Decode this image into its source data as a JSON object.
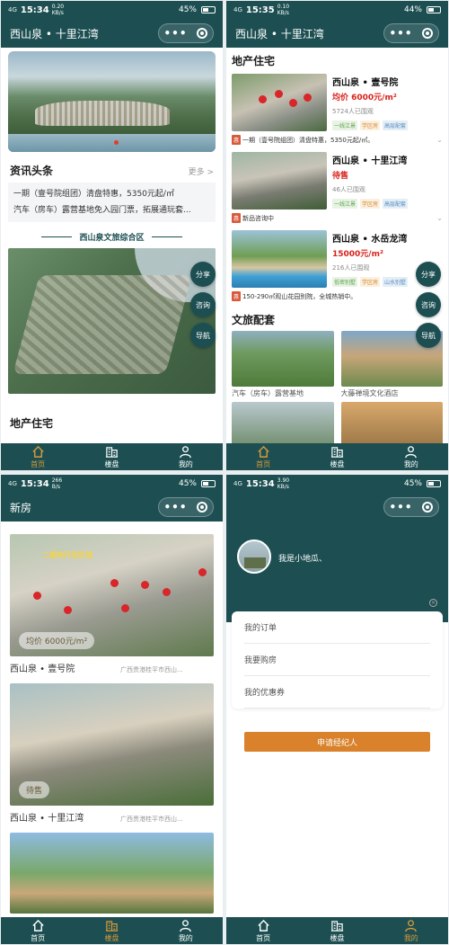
{
  "panel1": {
    "status": {
      "signal": "4G",
      "time": "15:34",
      "kbs_top": "0.20",
      "kbs_bottom": "KB/s",
      "battery": "45%"
    },
    "nav_title": "西山泉 • 十里江湾",
    "news_title": "资讯头条",
    "news_more": "更多 >",
    "news": [
      "一期（壹号院组团）清盘特惠，5350元起/㎡",
      "汽车（房车）露营基地免入园门票，拓展通玩套..."
    ],
    "map_title": "西山泉文旅综合区",
    "float_buttons": [
      "分享",
      "咨询",
      "导航"
    ],
    "estate_title": "地产住宅"
  },
  "panel2": {
    "status": {
      "signal": "4G",
      "time": "15:35",
      "kbs_top": "0.10",
      "kbs_bottom": "KB/s",
      "battery": "44%"
    },
    "nav_title": "西山泉 • 十里江湾",
    "section_title": "地产住宅",
    "properties": [
      {
        "name": "西山泉 • 壹号院",
        "price": "均价 6000元/m²",
        "views": "5724人已围观",
        "tags": [
          "一线江景",
          "学区房",
          "高层配套"
        ],
        "notice": "一期（壹号院组团）清盘特惠，5350元起/㎡。"
      },
      {
        "name": "西山泉 • 十里江湾",
        "price": "待售",
        "views": "46人已围观",
        "tags": [
          "一线江景",
          "学区房",
          "高层配套"
        ],
        "notice": "新品咨询中"
      },
      {
        "name": "西山泉 • 水岳龙湾",
        "price": "15000元/m²",
        "views": "216人已围观",
        "tags": [
          "低密别墅",
          "学区房",
          "山水别墅"
        ],
        "notice": "150-290㎡观山花园别院，全城热销中。"
      }
    ],
    "hui_label": "惠",
    "float_buttons": [
      "分享",
      "咨询",
      "导航"
    ],
    "culture_title": "文旅配套",
    "culture": [
      "汽车（房车）露营基地",
      "大藤禅境文化酒店"
    ]
  },
  "panel3": {
    "status": {
      "signal": "4G",
      "time": "15:34",
      "kbs_top": "266",
      "kbs_bottom": "B/s",
      "battery": "45%"
    },
    "nav_title": "新房",
    "cards": [
      {
        "badge": "均价 6000元/m²",
        "name": "西山泉 • 壹号院",
        "addr": "广西贵港桂平市西山..."
      },
      {
        "badge": "待售",
        "name": "西山泉 • 十里江湾",
        "addr": "广西贵港桂平市西山..."
      }
    ],
    "overlay_text": "二期待开发区域"
  },
  "panel4": {
    "status": {
      "signal": "4G",
      "time": "15:34",
      "kbs_top": "3.90",
      "kbs_bottom": "KB/s",
      "battery": "45%"
    },
    "user_name": "我是小地瓜、",
    "menu": [
      "我的订单",
      "我要购房",
      "我的优惠券"
    ],
    "apply_button": "申请经纪人"
  },
  "tabs": [
    "首页",
    "楼盘",
    "我的"
  ],
  "colors": {
    "primary": "#1d4f52",
    "accent": "#d79a3a",
    "price": "#d8231c",
    "button": "#d9822b"
  },
  "icons": [
    "home-icon",
    "building-icon",
    "user-icon",
    "more-dots-icon",
    "close-circle-icon"
  ]
}
